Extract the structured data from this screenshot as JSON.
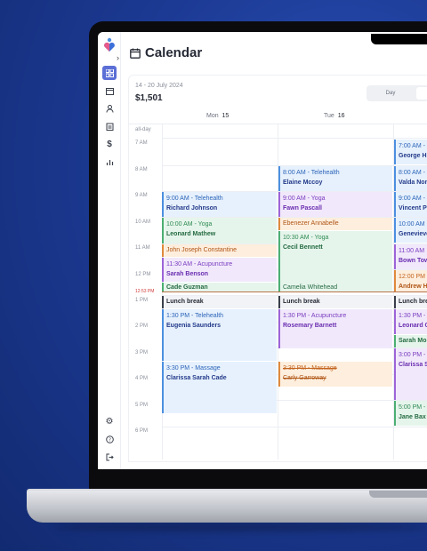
{
  "header": {
    "title": "Calendar"
  },
  "summary": {
    "date_range": "14 - 20 July 2024",
    "amount": "$1,501"
  },
  "view_toggle": {
    "day_label": "Day"
  },
  "days": [
    {
      "name": "Mon",
      "num": "15"
    },
    {
      "name": "Tue",
      "num": "16"
    }
  ],
  "all_day_label": "all-day",
  "times": [
    "7 AM",
    "8 AM",
    "9 AM",
    "10 AM",
    "11 AM",
    "12 PM",
    "1 PM",
    "2 PM",
    "3 PM",
    "4 PM",
    "5 PM",
    "6 PM"
  ],
  "current_time": "12:53 PM",
  "events": {
    "mon": [
      {
        "time": "9:00 AM - Telehealth",
        "name": "Richard Johnson"
      },
      {
        "time": "10:00 AM - Yoga",
        "name": "Leonard Mathew"
      },
      {
        "name": "John Joseph Constantine"
      },
      {
        "time": "11:30 AM - Acupuncture",
        "name": "Sarah Benson"
      },
      {
        "name": "Cade Guzman"
      },
      {
        "name": "Lunch break"
      },
      {
        "time": "1:30 PM - Telehealth",
        "name": "Eugenia Saunders"
      },
      {
        "time": "3:30 PM - Massage",
        "name": "Clarissa Sarah Cade"
      }
    ],
    "tue": [
      {
        "time": "8:00 AM - Telehealth",
        "name": "Elaine Mccoy"
      },
      {
        "time": "9:00 AM - Yoga",
        "name": "Fawn Pascall"
      },
      {
        "name": "Ebenezer Annabelle"
      },
      {
        "time": "10:30 AM - Yoga",
        "name": "Cecil Bennett"
      },
      {
        "name": "Camelia Whitehead"
      },
      {
        "name": "Lunch break"
      },
      {
        "time": "1:30 PM - Acupuncture",
        "name": "Rosemary Barnett"
      },
      {
        "time": "3:30 PM - Massage",
        "name": "Carly Garroway"
      }
    ],
    "wed": [
      {
        "time": "7:00 AM -",
        "name": "George H"
      },
      {
        "time": "8:00 AM -",
        "name": "Valda Nor"
      },
      {
        "time": "9:00 AM -",
        "name": "Vincent P"
      },
      {
        "time": "10:00 AM",
        "name": "Genevieve"
      },
      {
        "time": "11:00 AM",
        "name": "Bown Tow"
      },
      {
        "time": "12:00 PM",
        "name": "Andrew H"
      },
      {
        "name": "Lunch bre"
      },
      {
        "time": "1:30 PM -",
        "name": "Leonard C"
      },
      {
        "name": "Sarah Mo"
      },
      {
        "time": "3:00 PM -",
        "name": "Clarissa S"
      },
      {
        "time": "5:00 PM -",
        "name": "Jane Bax"
      }
    ]
  },
  "colors": {
    "accent": "#5b6fd6",
    "telehealth": "#4c8fe0",
    "yoga": "#4caf73",
    "acupuncture": "#9d64d8",
    "orange": "#e08a3c",
    "now_line": "#d03b3b"
  },
  "sidebar_icons": [
    "grid-icon",
    "calendar-icon",
    "user-icon",
    "clipboard-icon",
    "dollar-icon",
    "chart-icon",
    "settings-icon",
    "help-icon",
    "logout-icon"
  ]
}
